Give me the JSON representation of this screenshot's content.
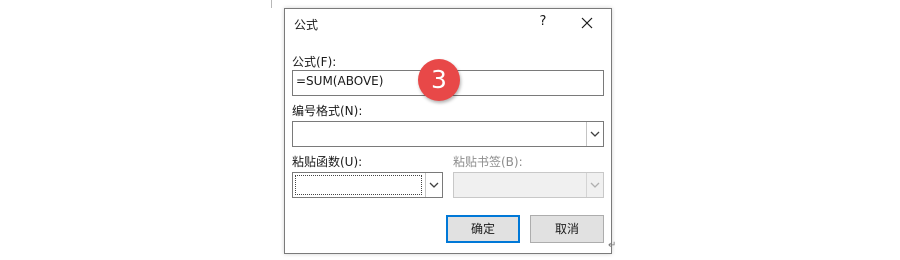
{
  "dialog": {
    "title": "公式",
    "help_label": "?",
    "formula_label": "公式(F):",
    "formula_value": "=SUM(ABOVE)",
    "number_format_label": "编号格式(N):",
    "number_format_value": "",
    "paste_function_label": "粘贴函数(U):",
    "paste_function_value": "",
    "paste_bookmark_label": "粘贴书签(B):",
    "paste_bookmark_value": "",
    "ok_label": "确定",
    "cancel_label": "取消"
  },
  "annotation": {
    "step_number": "3"
  },
  "document": {
    "paragraph_mark": "↵"
  },
  "colors": {
    "badge": "#e84848",
    "focus_border": "#0078d7",
    "button_face": "#e1e1e1"
  },
  "icons": [
    "help-icon",
    "close-icon",
    "chevron-down-icon"
  ]
}
